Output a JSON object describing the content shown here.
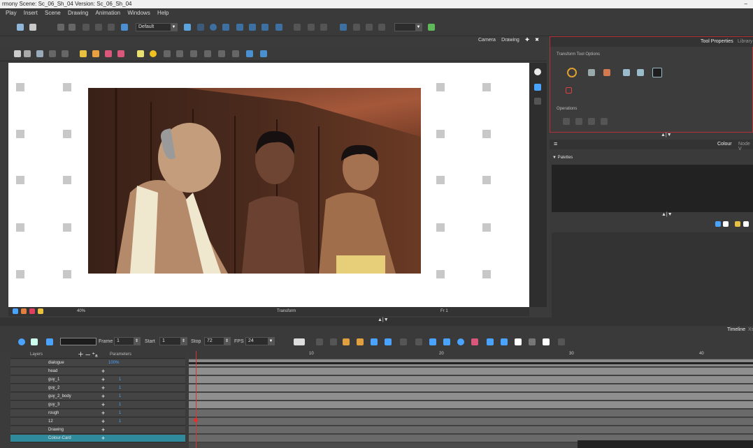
{
  "window": {
    "title": "rmony Scene: Sc_06_Sh_04 Version: Sc_06_Sh_04",
    "minimize": "–"
  },
  "menu": [
    "Play",
    "Insert",
    "Scene",
    "Drawing",
    "Animation",
    "Windows",
    "Help"
  ],
  "toolbar": {
    "workspace_value": "Default"
  },
  "view_tabs": [
    "Camera",
    "Drawing"
  ],
  "view_status": {
    "zoom": "40%",
    "tool": "Transform",
    "frame": "Fr 1"
  },
  "tool_properties": {
    "tabs": [
      "Tool Properties",
      "Library"
    ],
    "section1": "Transform Tool Options",
    "section2": "Operations"
  },
  "colour_panel": {
    "tabs": [
      "Colour",
      "Node V"
    ],
    "palettes_label": "Palettes"
  },
  "timeline": {
    "tabs": [
      "Timeline",
      "Xs"
    ],
    "frame_label": "Frame",
    "frame_value": "1",
    "start_label": "Start",
    "start_value": "1",
    "stop_label": "Stop",
    "stop_value": "72",
    "fps_label": "FPS",
    "fps_value": "24",
    "layers_header": "Layers",
    "params_header": "Parameters",
    "ruler": [
      "10",
      "20",
      "30",
      "40"
    ]
  },
  "layers": [
    {
      "name": "dialogue",
      "param": "100%"
    },
    {
      "name": "head",
      "param": ""
    },
    {
      "name": "guy_1",
      "param": "1"
    },
    {
      "name": "guy_2",
      "param": "1"
    },
    {
      "name": "guy_2_body",
      "param": "1"
    },
    {
      "name": "guy_3",
      "param": "1"
    },
    {
      "name": "rough",
      "param": "1"
    },
    {
      "name": "12",
      "param": "1"
    },
    {
      "name": "Drawing",
      "param": ""
    },
    {
      "name": "Colour-Card",
      "param": ""
    }
  ],
  "colors": {
    "accent_red": "#b3323a",
    "playhead": "#e03030",
    "selected_layer": "#2f8a9c"
  }
}
